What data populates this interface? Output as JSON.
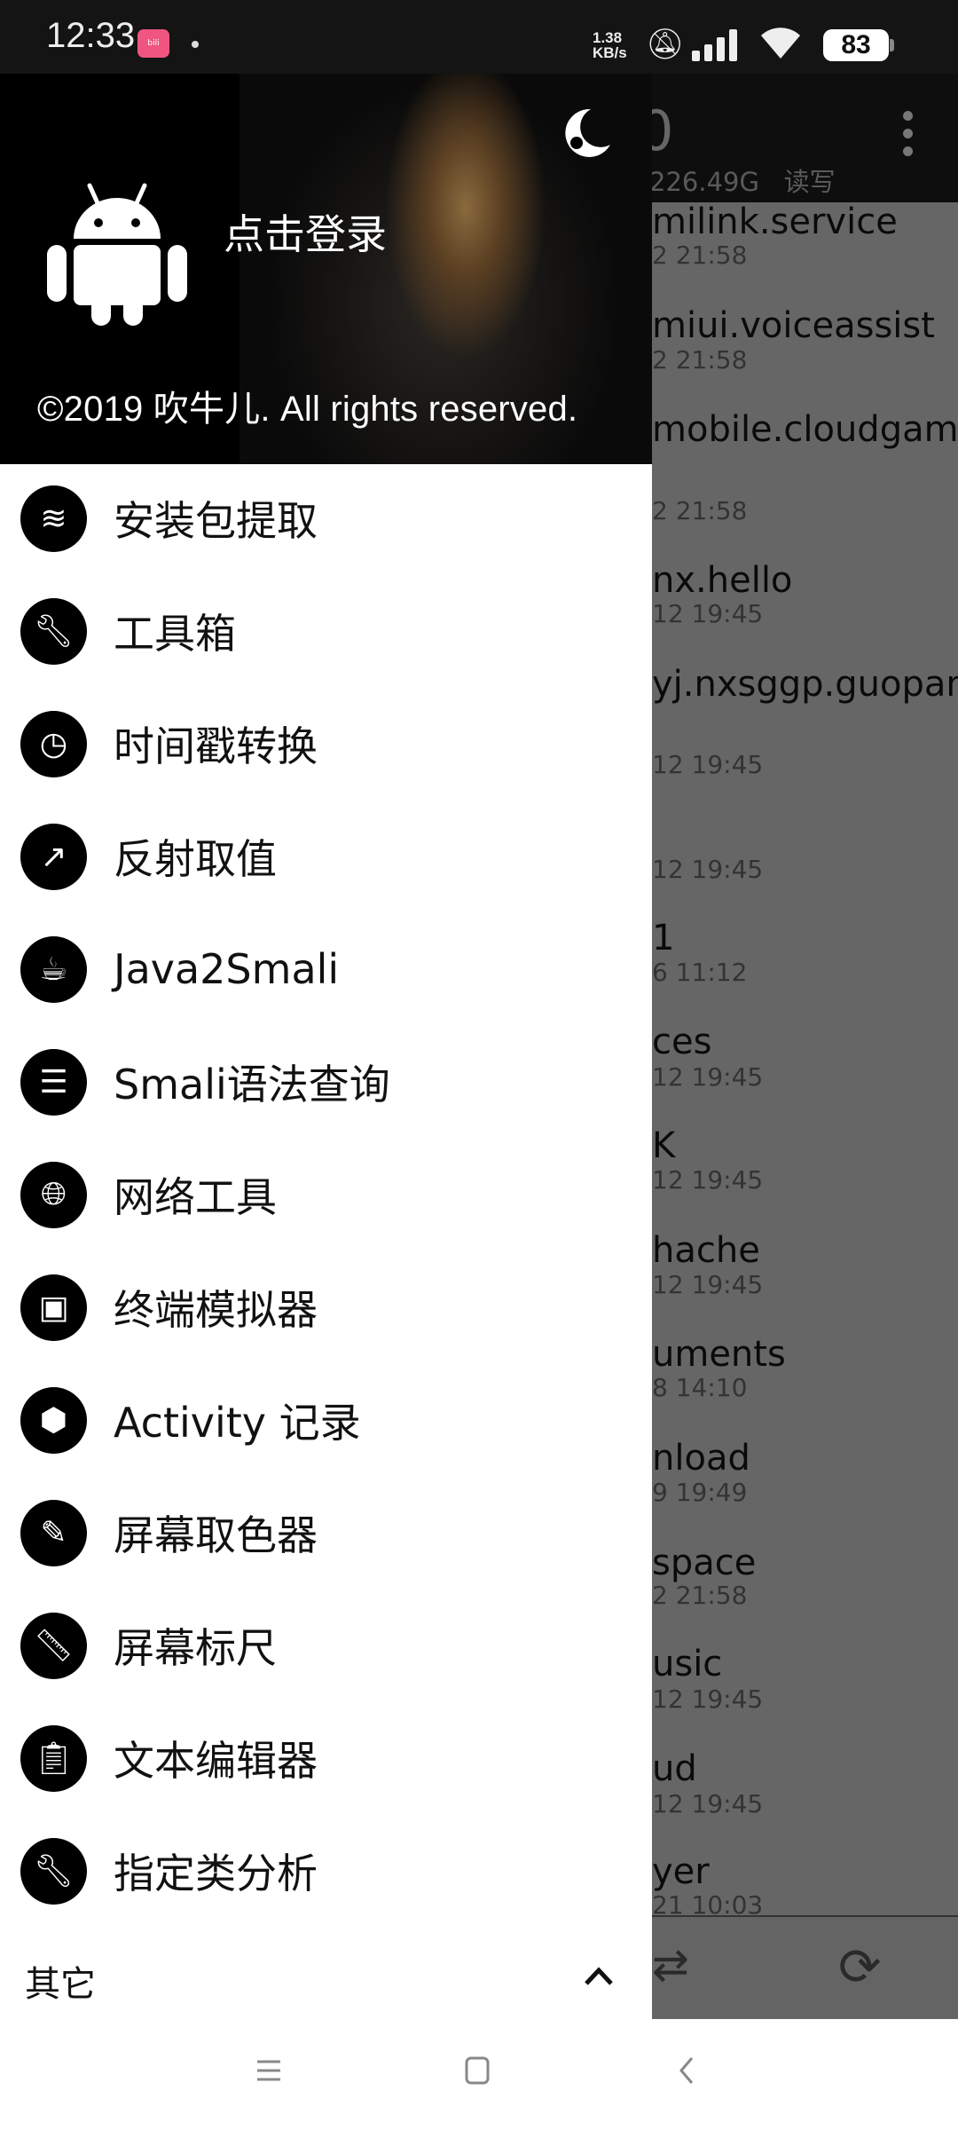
{
  "status_bar": {
    "time": "12:33",
    "app_badge": "bilibili",
    "net_speed_value": "1.38",
    "net_speed_unit": "KB/s",
    "battery": "83"
  },
  "background_app": {
    "title_fragment": "0",
    "storage": "226.49G",
    "permission": "读写",
    "files": [
      {
        "name": "milink.service",
        "date": "2 21:58"
      },
      {
        "name": "miui.voiceassist",
        "date": "2 21:58"
      },
      {
        "name": "mobile.cloudgame",
        "date": "2 21:58"
      },
      {
        "name": "nx.hello",
        "date": "12 19:45"
      },
      {
        "name": "yj.nxsggp.guopan.l",
        "date": "12 19:45"
      },
      {
        "name": "",
        "date": "12 19:45"
      },
      {
        "name": "1",
        "date": "6 11:12"
      },
      {
        "name": "ces",
        "date": "12 19:45"
      },
      {
        "name": "K",
        "date": "12 19:45"
      },
      {
        "name": "hache",
        "date": "12 19:45"
      },
      {
        "name": "uments",
        "date": "8 14:10"
      },
      {
        "name": "nload",
        "date": "9 19:49"
      },
      {
        "name": "space",
        "date": "2 21:58"
      },
      {
        "name": "usic",
        "date": "12 19:45"
      },
      {
        "name": "ud",
        "date": "12 19:45"
      },
      {
        "name": "yer",
        "date": "21 10:03"
      }
    ]
  },
  "drawer": {
    "login": "点击登录",
    "copyright": "©2019 吹牛儿. All rights reserved.",
    "items": [
      {
        "label": "安装包提取",
        "icon": "layers-icon"
      },
      {
        "label": "工具箱",
        "icon": "wrench-icon"
      },
      {
        "label": "时间戳转换",
        "icon": "clock-icon"
      },
      {
        "label": "反射取值",
        "icon": "trending-icon"
      },
      {
        "label": "Java2Smali",
        "icon": "java-icon"
      },
      {
        "label": "Smali语法查询",
        "icon": "book-icon"
      },
      {
        "label": "网络工具",
        "icon": "globe-icon"
      },
      {
        "label": "终端模拟器",
        "icon": "terminal-icon"
      },
      {
        "label": "Activity 记录",
        "icon": "cube-icon"
      },
      {
        "label": "屏幕取色器",
        "icon": "eyedropper-icon"
      },
      {
        "label": "屏幕标尺",
        "icon": "ruler-icon"
      },
      {
        "label": "文本编辑器",
        "icon": "clipboard-icon"
      },
      {
        "label": "指定类分析",
        "icon": "wrench-icon"
      }
    ],
    "section_other": "其它"
  }
}
